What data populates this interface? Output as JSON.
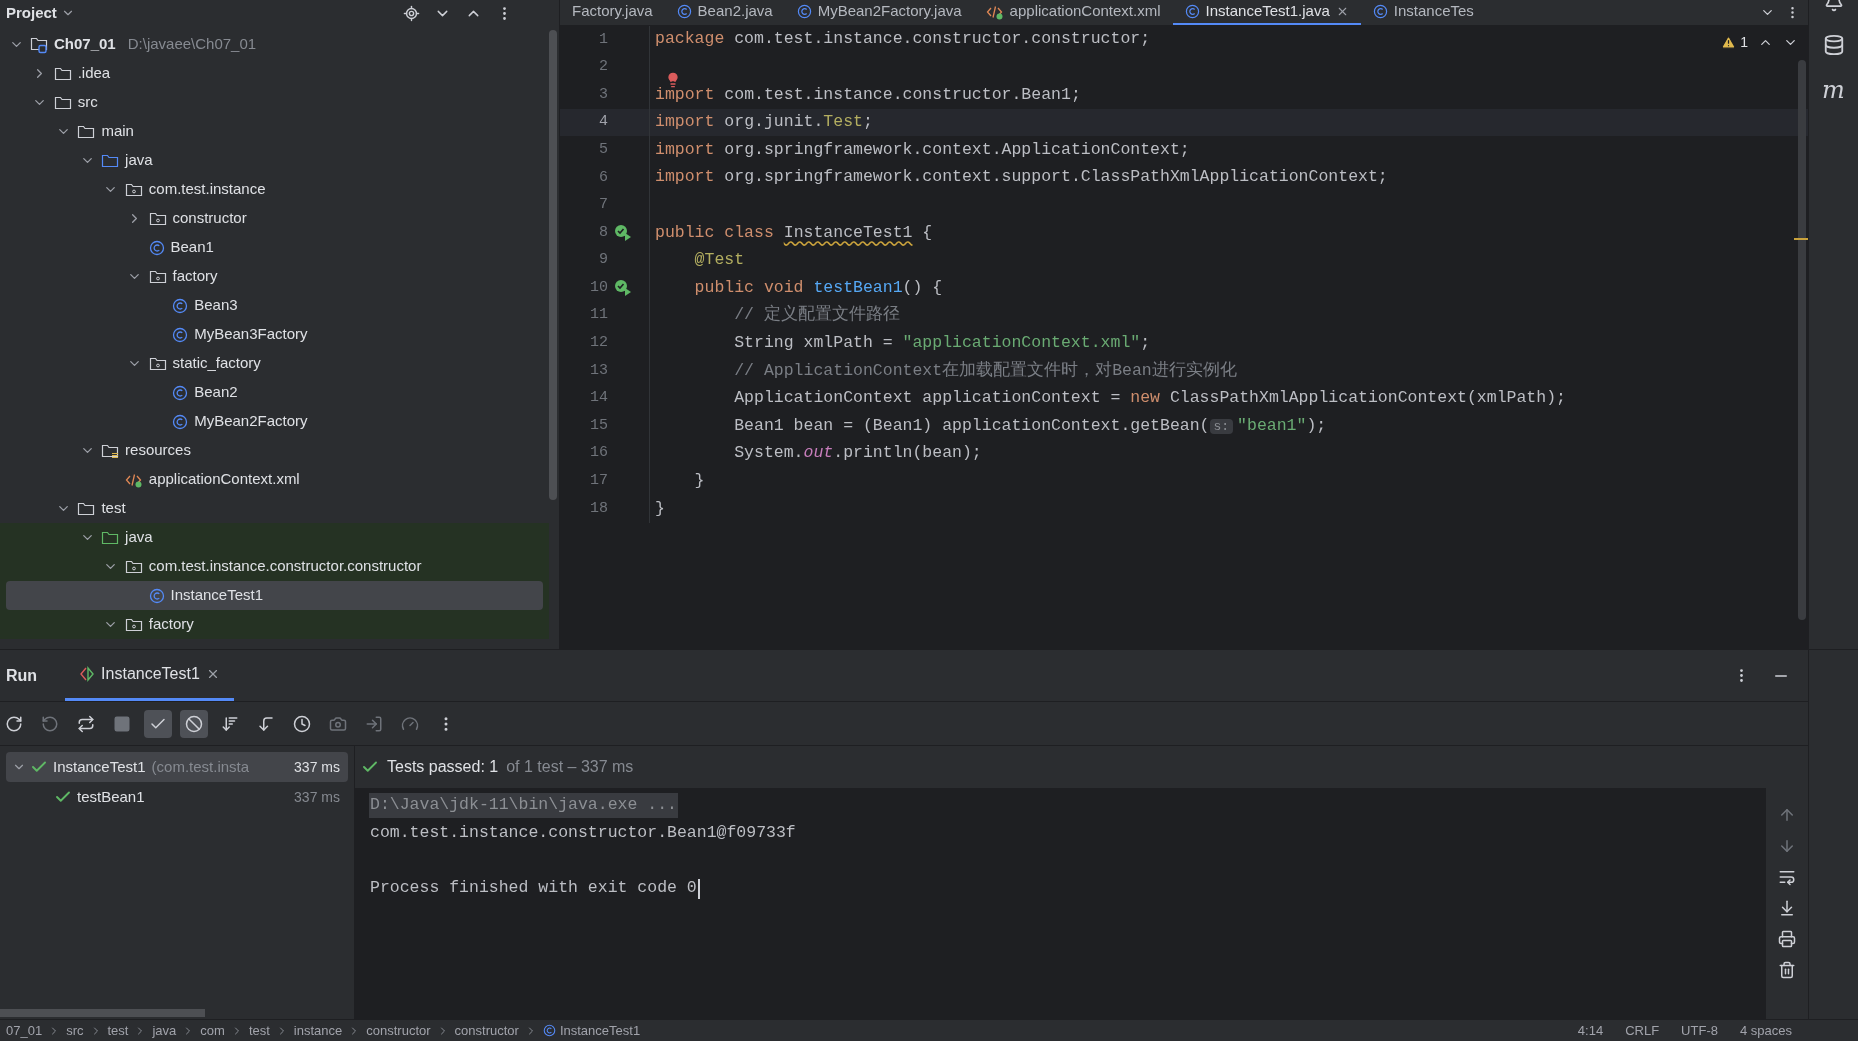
{
  "project_panel": {
    "title": "Project",
    "tree": [
      {
        "label": "Ch07_01",
        "path": "D:\\javaee\\Ch07_01",
        "kind": "module",
        "expanded": true,
        "selected": false,
        "test_scope": false,
        "children": [
          {
            "label": ".idea",
            "kind": "folder",
            "expanded": false,
            "selected": false,
            "test_scope": false
          },
          {
            "label": "src",
            "kind": "folder",
            "expanded": true,
            "selected": false,
            "test_scope": false,
            "children": [
              {
                "label": "main",
                "kind": "folder",
                "expanded": true,
                "selected": false,
                "test_scope": false,
                "children": [
                  {
                    "label": "java",
                    "kind": "source-folder",
                    "expanded": true,
                    "selected": false,
                    "test_scope": false,
                    "children": [
                      {
                        "label": "com.test.instance",
                        "kind": "package",
                        "expanded": true,
                        "selected": false,
                        "test_scope": false,
                        "children": [
                          {
                            "label": "constructor",
                            "kind": "package",
                            "expanded": false,
                            "selected": false,
                            "test_scope": false
                          },
                          {
                            "label": "Bean1",
                            "kind": "class",
                            "selected": false,
                            "test_scope": false
                          },
                          {
                            "label": "factory",
                            "kind": "package",
                            "expanded": true,
                            "selected": false,
                            "test_scope": false,
                            "children": [
                              {
                                "label": "Bean3",
                                "kind": "class",
                                "selected": false,
                                "test_scope": false
                              },
                              {
                                "label": "MyBean3Factory",
                                "kind": "class",
                                "selected": false,
                                "test_scope": false
                              }
                            ]
                          },
                          {
                            "label": "static_factory",
                            "kind": "package",
                            "expanded": true,
                            "selected": false,
                            "test_scope": false,
                            "children": [
                              {
                                "label": "Bean2",
                                "kind": "class",
                                "selected": false,
                                "test_scope": false
                              },
                              {
                                "label": "MyBean2Factory",
                                "kind": "class",
                                "selected": false,
                                "test_scope": false
                              }
                            ]
                          }
                        ]
                      }
                    ]
                  },
                  {
                    "label": "resources",
                    "kind": "resources",
                    "expanded": true,
                    "selected": false,
                    "test_scope": false,
                    "children": [
                      {
                        "label": "applicationContext.xml",
                        "kind": "xml",
                        "selected": false,
                        "test_scope": false
                      }
                    ]
                  }
                ]
              },
              {
                "label": "test",
                "kind": "folder",
                "expanded": true,
                "selected": false,
                "test_scope": false,
                "children": [
                  {
                    "label": "java",
                    "kind": "test-folder",
                    "expanded": true,
                    "selected": false,
                    "test_scope": true,
                    "children": [
                      {
                        "label": "com.test.instance.constructor.constructor",
                        "kind": "package",
                        "expanded": true,
                        "selected": false,
                        "test_scope": true,
                        "children": [
                          {
                            "label": "InstanceTest1",
                            "kind": "class",
                            "selected": true,
                            "test_scope": true
                          }
                        ]
                      },
                      {
                        "label": "factory",
                        "kind": "package",
                        "expanded": true,
                        "selected": false,
                        "test_scope": true
                      }
                    ]
                  }
                ]
              }
            ]
          }
        ]
      }
    ]
  },
  "editor": {
    "tabs": [
      {
        "label": "Factory.java",
        "kind": "plain",
        "selected": false
      },
      {
        "label": "Bean2.java",
        "kind": "class",
        "selected": false
      },
      {
        "label": "MyBean2Factory.java",
        "kind": "class",
        "selected": false
      },
      {
        "label": "applicationContext.xml",
        "kind": "xml",
        "selected": false
      },
      {
        "label": "InstanceTest1.java",
        "kind": "class",
        "selected": true
      },
      {
        "label": "InstanceTes",
        "kind": "class",
        "selected": false
      }
    ],
    "warning_count": "1",
    "lines": [
      {
        "number": "1",
        "kind": "plain",
        "current": false,
        "tokens": [
          {
            "kind": "keyword",
            "text": "package"
          },
          {
            "kind": "plain",
            "text": " com.test.instance.constructor.constructor;"
          }
        ]
      },
      {
        "number": "2",
        "kind": "plain",
        "current": false
      },
      {
        "number": "3",
        "kind": "error-bulb",
        "current": false,
        "tokens": [
          {
            "kind": "keyword",
            "text": "import"
          },
          {
            "kind": "plain",
            "text": " com.test.instance.constructor.Bean1;"
          }
        ]
      },
      {
        "number": "4",
        "kind": "plain",
        "current": true,
        "tokens": [
          {
            "kind": "keyword",
            "text": "import"
          },
          {
            "kind": "plain",
            "text": " org.junit."
          },
          {
            "kind": "annotation",
            "text": "Test"
          },
          {
            "kind": "plain",
            "text": ";"
          }
        ]
      },
      {
        "number": "5",
        "kind": "plain",
        "current": false,
        "tokens": [
          {
            "kind": "keyword",
            "text": "import"
          },
          {
            "kind": "plain",
            "text": " org.springframework.context.ApplicationContext;"
          }
        ]
      },
      {
        "number": "6",
        "kind": "plain",
        "current": false,
        "tokens": [
          {
            "kind": "keyword",
            "text": "import"
          },
          {
            "kind": "plain",
            "text": " org.springframework.context.support.ClassPathXmlApplicationContext;"
          }
        ]
      },
      {
        "number": "7",
        "kind": "plain",
        "current": false
      },
      {
        "number": "8",
        "kind": "run-test",
        "current": false,
        "tokens": [
          {
            "kind": "keyword",
            "text": "public class "
          },
          {
            "kind": "warning",
            "text": "InstanceTest1"
          },
          {
            "kind": "plain",
            "text": " {"
          }
        ]
      },
      {
        "number": "9",
        "kind": "plain",
        "current": false,
        "tokens": [
          {
            "kind": "annotation",
            "text": "    @Test"
          }
        ]
      },
      {
        "number": "10",
        "kind": "run-test",
        "current": false,
        "tokens": [
          {
            "kind": "keyword",
            "text": "    public void "
          },
          {
            "kind": "method",
            "text": "testBean1"
          },
          {
            "kind": "plain",
            "text": "() {"
          }
        ]
      },
      {
        "number": "11",
        "kind": "plain",
        "current": false,
        "tokens": [
          {
            "kind": "comment",
            "text": "        // 定义配置文件路径"
          }
        ]
      },
      {
        "number": "12",
        "kind": "plain",
        "current": false,
        "tokens": [
          {
            "kind": "plain",
            "text": "        String xmlPath = "
          },
          {
            "kind": "string",
            "text": "\"applicationContext.xml\""
          },
          {
            "kind": "plain",
            "text": ";"
          }
        ]
      },
      {
        "number": "13",
        "kind": "plain",
        "current": false,
        "tokens": [
          {
            "kind": "comment",
            "text": "        // ApplicationContext在加载配置文件时，对Bean进行实例化"
          }
        ]
      },
      {
        "number": "14",
        "kind": "plain",
        "current": false,
        "tokens": [
          {
            "kind": "plain",
            "text": "        ApplicationContext applicationContext = "
          },
          {
            "kind": "keyword",
            "text": "new"
          },
          {
            "kind": "plain",
            "text": " ClassPathXmlApplicationContext(xmlPath);"
          }
        ]
      },
      {
        "number": "15",
        "kind": "plain",
        "current": false,
        "tokens": [
          {
            "kind": "plain",
            "text": "        Bean1 bean = (Bean1) applicationContext.getBean("
          },
          {
            "kind": "hint",
            "text": "s:"
          },
          {
            "kind": "string",
            "text": "\"bean1\""
          },
          {
            "kind": "plain",
            "text": ");"
          }
        ]
      },
      {
        "number": "16",
        "kind": "plain",
        "current": false,
        "tokens": [
          {
            "kind": "plain",
            "text": "        System."
          },
          {
            "kind": "field",
            "text": "out"
          },
          {
            "kind": "plain",
            "text": ".println(bean);"
          }
        ]
      },
      {
        "number": "17",
        "kind": "plain",
        "current": false,
        "tokens": [
          {
            "kind": "plain",
            "text": "    }"
          }
        ]
      },
      {
        "number": "18",
        "kind": "plain",
        "current": false,
        "tokens": [
          {
            "kind": "plain",
            "text": "}"
          }
        ]
      }
    ]
  },
  "right_strip": [
    {
      "kind": "bell"
    },
    {
      "kind": "database"
    },
    {
      "kind": "maven",
      "glyph": "m"
    }
  ],
  "run_panel": {
    "title": "Run",
    "tabs": [
      {
        "label": "InstanceTest1",
        "selected": true
      }
    ],
    "toolbar": [
      {
        "kind": "rerun",
        "disabled": false,
        "selected": false
      },
      {
        "kind": "rerun-failed",
        "disabled": true,
        "selected": false
      },
      {
        "kind": "auto-test",
        "disabled": false,
        "selected": false
      },
      {
        "kind": "stop",
        "disabled": true,
        "selected": false
      },
      {
        "kind": "show-passed",
        "disabled": false,
        "selected": true
      },
      {
        "kind": "show-ignored",
        "disabled": false,
        "selected": true
      },
      {
        "kind": "sort",
        "disabled": false,
        "selected": false
      },
      {
        "kind": "collapse",
        "disabled": false,
        "selected": false
      },
      {
        "kind": "history",
        "disabled": false,
        "selected": false
      },
      {
        "kind": "camera",
        "disabled": true,
        "selected": false
      },
      {
        "kind": "import",
        "disabled": true,
        "selected": false
      },
      {
        "kind": "gauge",
        "disabled": true,
        "selected": false
      },
      {
        "kind": "more",
        "disabled": false,
        "selected": false
      }
    ],
    "tests": [
      {
        "label": "InstanceTest1",
        "detail": "(com.test.insta",
        "time": "337 ms",
        "passed": true,
        "expanded": true,
        "selected": true,
        "children": [
          {
            "label": "testBean1",
            "time": "337 ms",
            "passed": true,
            "selected": false
          }
        ]
      }
    ],
    "result": {
      "passed": true,
      "headline": "Tests passed: 1",
      "summary": "of 1 test – 337 ms"
    },
    "console": [
      {
        "kind": "command",
        "text": "D:\\Java\\jdk-11\\bin\\java.exe ..."
      },
      {
        "kind": "output",
        "text": "com.test.instance.constructor.Bean1@f09733f"
      },
      {
        "kind": "blank"
      },
      {
        "kind": "exit",
        "text": "Process finished with exit code 0"
      }
    ],
    "console_tools": [
      {
        "kind": "up",
        "disabled": true
      },
      {
        "kind": "down",
        "disabled": true
      },
      {
        "kind": "wrap",
        "disabled": false
      },
      {
        "kind": "scroll-end",
        "disabled": false
      },
      {
        "kind": "print",
        "disabled": false
      },
      {
        "kind": "trash",
        "disabled": false
      }
    ]
  },
  "status_bar": {
    "breadcrumbs": [
      {
        "label": "07_01",
        "kind": "plain"
      },
      {
        "label": "src",
        "kind": "plain"
      },
      {
        "label": "test",
        "kind": "plain"
      },
      {
        "label": "java",
        "kind": "plain"
      },
      {
        "label": "com",
        "kind": "plain"
      },
      {
        "label": "test",
        "kind": "plain"
      },
      {
        "label": "instance",
        "kind": "plain"
      },
      {
        "label": "constructor",
        "kind": "plain"
      },
      {
        "label": "constructor",
        "kind": "plain"
      },
      {
        "label": "InstanceTest1",
        "kind": "class"
      }
    ],
    "items": [
      "4:14",
      "CRLF",
      "UTF-8",
      "4 spaces"
    ]
  }
}
